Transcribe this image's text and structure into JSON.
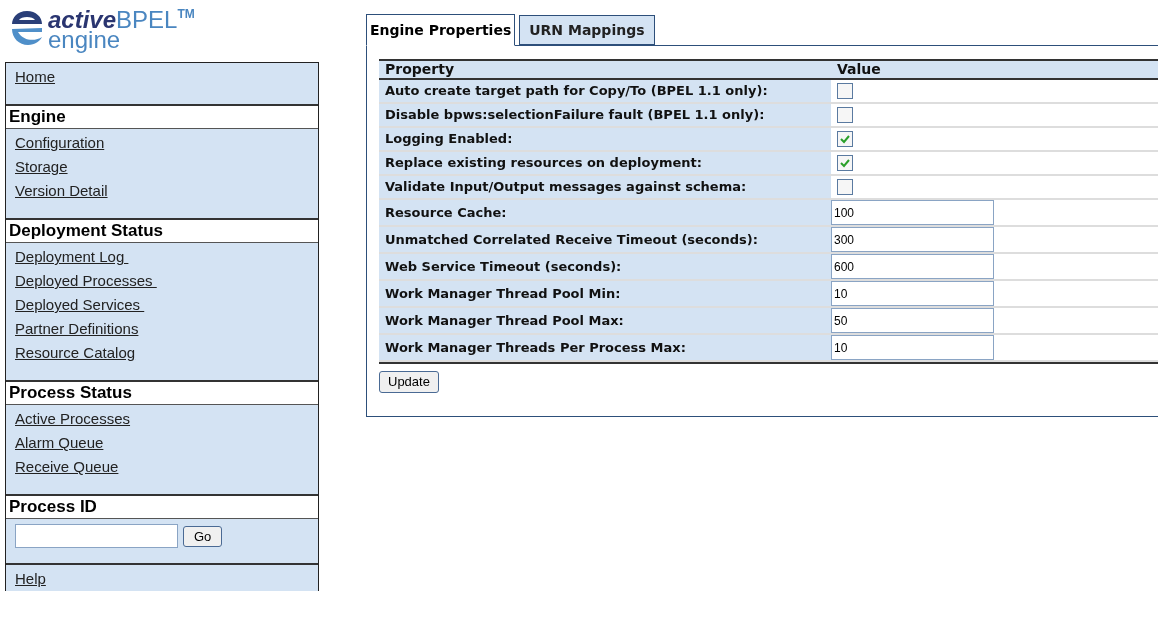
{
  "logo": {
    "word_1": "active",
    "word_2": "BPEL",
    "mark": "TM",
    "word_3": "engine"
  },
  "sidebar": {
    "groups": [
      {
        "links": [
          "Home"
        ]
      },
      {
        "heading": "Engine",
        "links": [
          "Configuration",
          "Storage",
          "Version Detail"
        ]
      },
      {
        "heading": "Deployment Status",
        "links": [
          "Deployment Log ",
          "Deployed Processes ",
          "Deployed Services ",
          "Partner Definitions",
          "Resource Catalog"
        ]
      },
      {
        "heading": "Process Status",
        "links": [
          "Active Processes",
          "Alarm Queue",
          "Receive Queue"
        ]
      },
      {
        "heading": "Process ID",
        "form": {
          "button": "Go"
        }
      },
      {
        "links": [
          "Help"
        ]
      }
    ]
  },
  "tabs": [
    {
      "label": "Engine Properties",
      "selected": true
    },
    {
      "label": "URN Mappings",
      "selected": false
    }
  ],
  "table": {
    "columns": [
      "Property",
      "Value"
    ],
    "rows": [
      {
        "kind": "checkbox",
        "label": "Auto create target path for Copy/To (BPEL 1.1 only):",
        "checked": false
      },
      {
        "kind": "checkbox",
        "label": "Disable bpws:selectionFailure fault (BPEL 1.1 only):",
        "checked": false
      },
      {
        "kind": "checkbox",
        "label": "Logging Enabled:",
        "checked": true
      },
      {
        "kind": "checkbox",
        "label": "Replace existing resources on deployment:",
        "checked": true
      },
      {
        "kind": "checkbox",
        "label": "Validate Input/Output messages against schema:",
        "checked": false
      },
      {
        "kind": "text",
        "label": "Resource Cache:",
        "value": "100"
      },
      {
        "kind": "text",
        "label": "Unmatched Correlated Receive Timeout (seconds):",
        "value": "300"
      },
      {
        "kind": "text",
        "label": "Web Service Timeout (seconds):",
        "value": "600"
      },
      {
        "kind": "text",
        "label": "Work Manager Thread Pool Min:",
        "value": "10"
      },
      {
        "kind": "text",
        "label": "Work Manager Thread Pool Max:",
        "value": "50"
      },
      {
        "kind": "text",
        "label": "Work Manager Threads Per Process Max:",
        "value": "10"
      }
    ]
  },
  "update_button": "Update"
}
